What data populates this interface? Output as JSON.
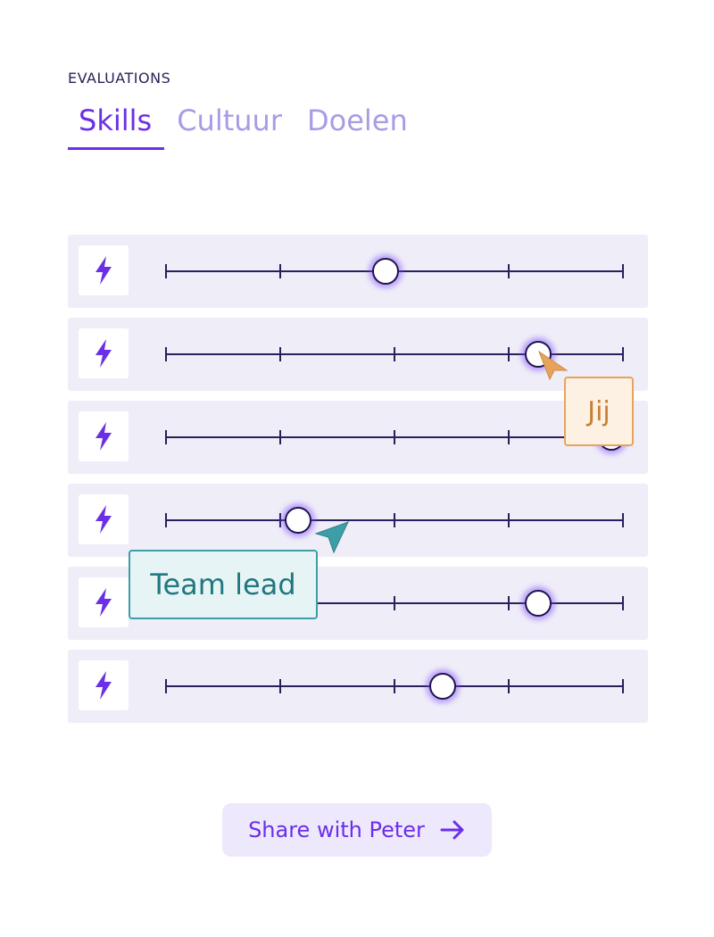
{
  "section": {
    "label": "EVALUATIONS"
  },
  "tabs": [
    {
      "label": "Skills",
      "active": true
    },
    {
      "label": "Cultuur",
      "active": false
    },
    {
      "label": "Doelen",
      "active": false
    }
  ],
  "scale": {
    "steps": 4
  },
  "rows": [
    {
      "icon": "lightning-icon",
      "value": 0.48
    },
    {
      "icon": "lightning-icon",
      "value": 0.815
    },
    {
      "icon": "lightning-icon",
      "value": 0.975
    },
    {
      "icon": "lightning-icon",
      "value": 0.29
    },
    {
      "icon": "lightning-icon",
      "value": 0.815
    },
    {
      "icon": "lightning-icon",
      "value": 0.605
    }
  ],
  "tooltips": {
    "you": {
      "label": "Jij",
      "color": "#e7a35a"
    },
    "team_lead": {
      "label": "Team lead",
      "color": "#3d9ea7"
    }
  },
  "cta": {
    "label": "Share with Peter",
    "icon": "arrow-right-icon"
  },
  "colors": {
    "accent": "#6b2fe8",
    "row_bg": "#efedf8",
    "track": "#2a1f5c"
  }
}
